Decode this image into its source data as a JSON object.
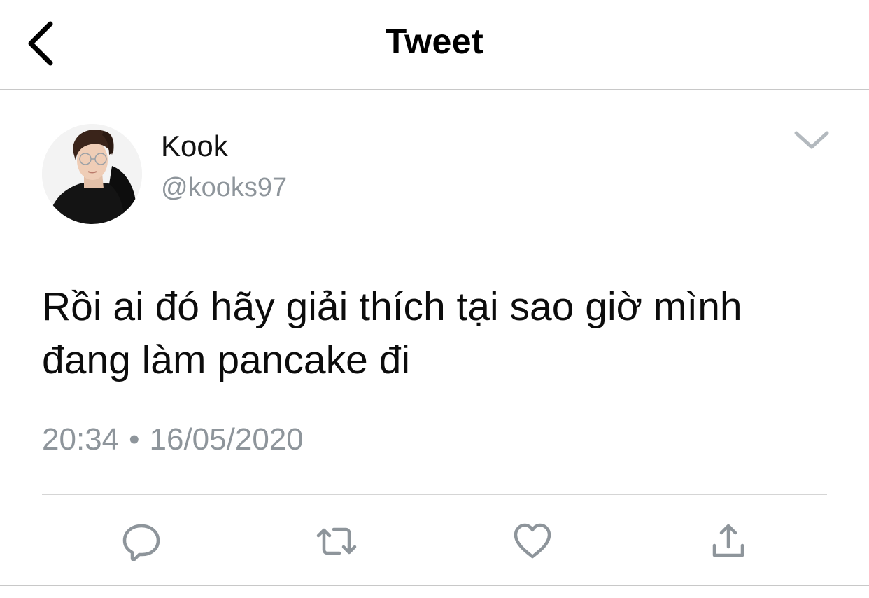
{
  "header": {
    "title": "Tweet",
    "back_icon": "chevron-left-icon"
  },
  "author": {
    "display_name": "Kook",
    "handle": "@kooks97",
    "menu_icon": "chevron-down-icon"
  },
  "tweet": {
    "text_line1": "Rồi ai đó hãy giải thích tại sao giờ mình",
    "text_line2": "đang làm pancake đi",
    "time": "20:34",
    "separator": "•",
    "date": "16/05/2020"
  },
  "actions": [
    {
      "name": "reply",
      "icon": "comment-icon"
    },
    {
      "name": "retweet",
      "icon": "retweet-icon"
    },
    {
      "name": "like",
      "icon": "heart-icon"
    },
    {
      "name": "share",
      "icon": "share-icon"
    }
  ],
  "colors": {
    "text": "#0f1419",
    "secondary": "#8e959b",
    "icon": "#8e959b",
    "divider": "#d5d5d5"
  }
}
